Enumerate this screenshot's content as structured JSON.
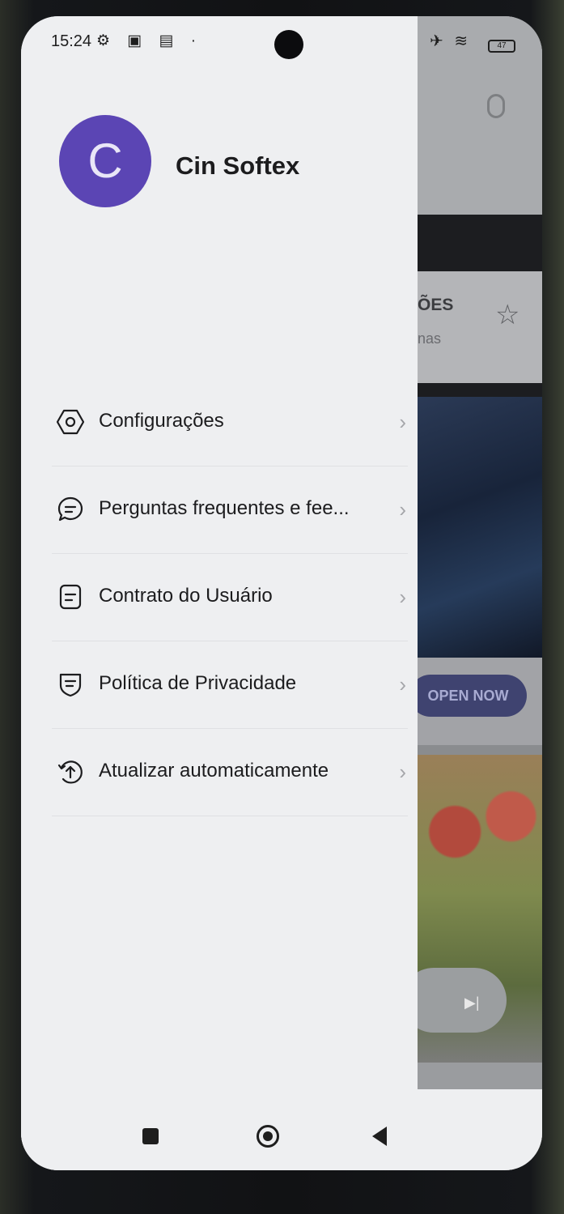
{
  "status_bar": {
    "time": "15:24",
    "left_icons": "⚙ ▣ ▤ ·",
    "right_icons": "✈ ≋",
    "battery": "47"
  },
  "profile": {
    "avatar_letter": "C",
    "avatar_color": "#5b45b4",
    "name": "Cin Softex"
  },
  "menu": {
    "items": [
      {
        "label": "Configurações",
        "icon": "settings-icon"
      },
      {
        "label": "Perguntas frequentes e fee...",
        "icon": "feedback-icon"
      },
      {
        "label": "Contrato do Usuário",
        "icon": "document-icon"
      },
      {
        "label": "Política de Privacidade",
        "icon": "shield-icon"
      },
      {
        "label": "Atualizar automaticamente",
        "icon": "update-icon"
      }
    ],
    "chevron": "›"
  },
  "background_app": {
    "card_title": "ÕES",
    "card_subtitle": "nas",
    "cta_label": "OPEN NOW"
  },
  "nav_bar": {
    "recent": "recent-apps-icon",
    "home": "home-icon",
    "back": "back-icon"
  }
}
